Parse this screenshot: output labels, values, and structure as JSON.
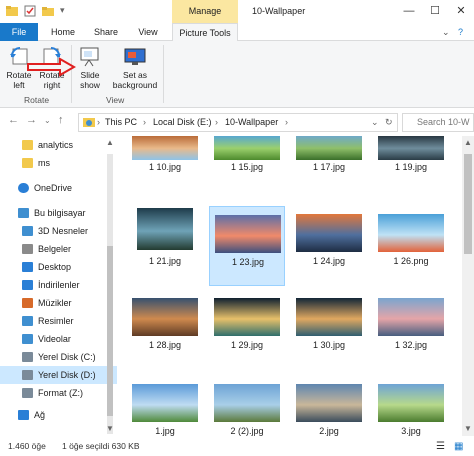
{
  "window": {
    "title": "10-Wallpaper",
    "contextual_tab": "Manage",
    "minimize": "—",
    "maximize": "☐",
    "close": "✕"
  },
  "tabs": [
    "File",
    "Home",
    "Share",
    "View",
    "Picture Tools"
  ],
  "ribbon": {
    "rotate_left": "Rotate\nleft",
    "rotate_right": "Rotate\nright",
    "slide_show": "Slide\nshow",
    "set_background": "Set as\nbackground",
    "group_rotate": "Rotate",
    "group_view": "View"
  },
  "address": {
    "crumbs": [
      "This PC",
      "Local Disk (E:)",
      "10-Wallpaper"
    ],
    "search_placeholder": "Search 10-W"
  },
  "nav": [
    {
      "label": "analytics",
      "icon": "folder-icon",
      "indent": 1
    },
    {
      "label": "ms",
      "icon": "folder-icon",
      "indent": 1
    },
    {
      "label": "OneDrive",
      "icon": "cloud-icon",
      "indent": 0
    },
    {
      "label": "Bu bilgisayar",
      "icon": "computer-icon",
      "indent": 0
    },
    {
      "label": "3D Nesneler",
      "icon": "3d-objects-icon",
      "indent": 1
    },
    {
      "label": "Belgeler",
      "icon": "documents-icon",
      "indent": 1
    },
    {
      "label": "Desktop",
      "icon": "desktop-icon",
      "indent": 1
    },
    {
      "label": "İndirilenler",
      "icon": "downloads-icon",
      "indent": 1
    },
    {
      "label": "Müzikler",
      "icon": "music-icon",
      "indent": 1
    },
    {
      "label": "Resimler",
      "icon": "pictures-icon",
      "indent": 1
    },
    {
      "label": "Videolar",
      "icon": "videos-icon",
      "indent": 1
    },
    {
      "label": "Yerel Disk (C:)",
      "icon": "drive-icon",
      "indent": 1
    },
    {
      "label": "Yerel Disk (D:)",
      "icon": "drive-icon",
      "indent": 1,
      "selected": true
    },
    {
      "label": "Format (Z:)",
      "icon": "drive-icon",
      "indent": 1
    },
    {
      "label": "Ağ",
      "icon": "network-icon",
      "indent": 0
    }
  ],
  "files": [
    {
      "name": "1 10.jpg",
      "palette": [
        "#b25f2c",
        "#e9b98a",
        "#8ec3e8"
      ]
    },
    {
      "name": "1 15.jpg",
      "palette": [
        "#4da1e0",
        "#9bd06d",
        "#4d8a2d"
      ]
    },
    {
      "name": "1 17.jpg",
      "palette": [
        "#6aa6d8",
        "#8fbf6a",
        "#3a6f2a"
      ]
    },
    {
      "name": "1 19.jpg",
      "palette": [
        "#1d2a34",
        "#6f8d9c",
        "#2a3c46"
      ]
    },
    {
      "name": "1 21.jpg",
      "palette": [
        "#1e3b4a",
        "#6fa3b7",
        "#233b30"
      ]
    },
    {
      "name": "1 23.jpg",
      "palette": [
        "#5c6fa8",
        "#f18a6a",
        "#3c4f7e"
      ]
    },
    {
      "name": "1 24.jpg",
      "palette": [
        "#e2783c",
        "#4f6f9e",
        "#1e2d43"
      ]
    },
    {
      "name": "1 26.png",
      "palette": [
        "#4aa0d8",
        "#bfe2f5",
        "#e2623a"
      ]
    },
    {
      "name": "1 28.jpg",
      "palette": [
        "#37516f",
        "#cf8a4e",
        "#5e3b25"
      ]
    },
    {
      "name": "1 29.jpg",
      "palette": [
        "#0f2030",
        "#e7c06a",
        "#2f6f6c"
      ]
    },
    {
      "name": "1 30.jpg",
      "palette": [
        "#122637",
        "#e0a860",
        "#2f5e70"
      ]
    },
    {
      "name": "1 32.jpg",
      "palette": [
        "#7aa5cf",
        "#e5a5a8",
        "#475e7f"
      ]
    },
    {
      "name": "1.jpg",
      "palette": [
        "#5a9ad8",
        "#bfdcf2",
        "#4f8a3a"
      ]
    },
    {
      "name": "2 (2).jpg",
      "palette": [
        "#6da3d5",
        "#a9cfe8",
        "#5b7a3a"
      ]
    },
    {
      "name": "2.jpg",
      "palette": [
        "#5e86b0",
        "#c9b79a",
        "#3b4c5c"
      ]
    },
    {
      "name": "3.jpg",
      "palette": [
        "#6ea4d6",
        "#b7d98b",
        "#4b7c2f"
      ]
    }
  ],
  "selected_file": "1 23.jpg",
  "status": {
    "count": "1.460 öğe",
    "selected": "1 öğe seçildi  630 KB"
  }
}
